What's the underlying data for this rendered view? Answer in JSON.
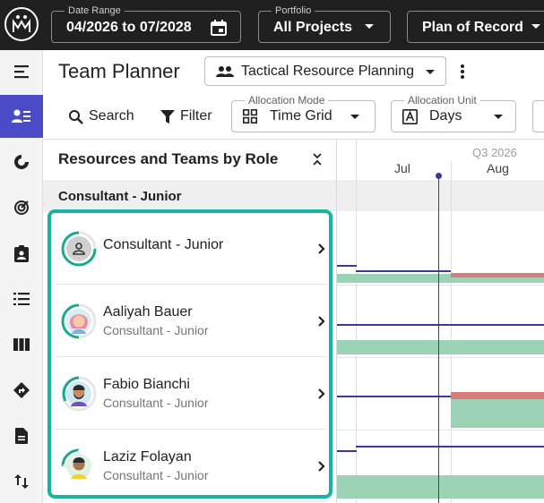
{
  "topbar": {
    "date_range": {
      "legend": "Date Range",
      "value": "04/2026 to 07/2028"
    },
    "portfolio": {
      "legend": "Portfolio",
      "value": "All Projects"
    },
    "plan": {
      "value": "Plan of Record"
    }
  },
  "nav": {
    "items": [
      {
        "icon": "menu-icon"
      },
      {
        "icon": "people-list-icon",
        "active": true
      },
      {
        "icon": "donut-chart-icon"
      },
      {
        "icon": "target-icon"
      },
      {
        "icon": "clipboard-user-icon"
      },
      {
        "icon": "list-icon"
      },
      {
        "icon": "columns-icon"
      },
      {
        "icon": "directions-icon"
      },
      {
        "icon": "document-icon"
      },
      {
        "icon": "swap-vertical-icon"
      }
    ]
  },
  "header": {
    "title": "Team Planner",
    "view": {
      "label": "Tactical Resource Planning",
      "icon": "people-icon"
    }
  },
  "toolbar": {
    "search_label": "Search",
    "filter_label": "Filter",
    "allocation_mode": {
      "legend": "Allocation Mode",
      "value": "Time Grid"
    },
    "allocation_unit": {
      "legend": "Allocation Unit",
      "value": "Days"
    }
  },
  "list": {
    "header": "Resources and Teams by Role",
    "group_label": "Consultant - Junior",
    "rows": [
      {
        "name": "Consultant - Junior",
        "role": "",
        "avatar": "generic-person"
      },
      {
        "name": "Aaliyah Bauer",
        "role": "Consultant - Junior",
        "avatar": "woman-pink-hair"
      },
      {
        "name": "Fabio Bianchi",
        "role": "Consultant - Junior",
        "avatar": "man-beard"
      },
      {
        "name": "Laziz Folayan",
        "role": "Consultant - Junior",
        "avatar": "man-yellow-shirt"
      }
    ]
  },
  "timeline": {
    "quarter_label": "Q3 2026",
    "months": [
      "Jul",
      "Aug"
    ]
  },
  "colors": {
    "topbar_bg": "#202020",
    "nav_active": "#4b4bc8",
    "highlight": "#17b3a3",
    "allocation_green": "#9cd3b6",
    "over_allocation_red": "#d97b7b",
    "today_line": "#3a3a9e"
  }
}
